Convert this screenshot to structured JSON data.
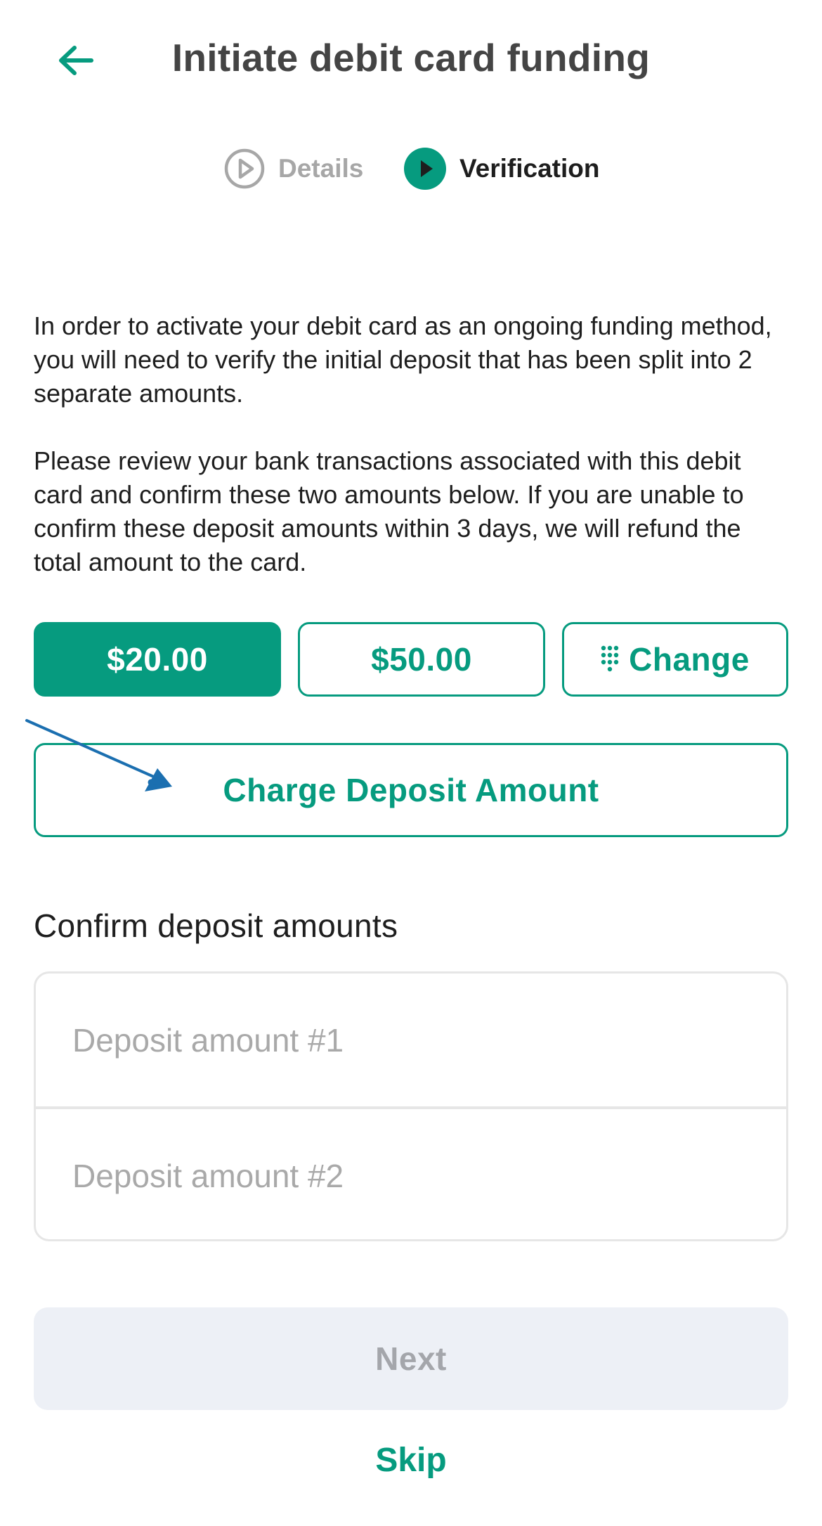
{
  "header": {
    "title": "Initiate debit card funding",
    "back_icon": "arrow-left-icon"
  },
  "stepper": {
    "steps": [
      {
        "label": "Details",
        "state": "inactive",
        "icon": "play-circle-outline-icon"
      },
      {
        "label": "Verification",
        "state": "active",
        "icon": "play-circle-filled-icon"
      }
    ]
  },
  "intro": {
    "paragraph_1": "In order to activate your debit card as an ongoing funding method, you will need to verify the initial deposit that has been split into 2 separate amounts.",
    "paragraph_2": "Please review your bank transactions associated with this debit card and confirm these two amounts below.  If you are unable to confirm these deposit amounts within 3 days, we will refund the total amount to the card."
  },
  "amounts": {
    "options": [
      {
        "label": "$20.00",
        "selected": true
      },
      {
        "label": "$50.00",
        "selected": false
      }
    ],
    "change_label": "Change",
    "change_icon": "keypad-icon"
  },
  "charge_button": {
    "label": "Charge Deposit Amount"
  },
  "confirm": {
    "title": "Confirm deposit amounts",
    "field_1_placeholder": "Deposit amount #1",
    "field_2_placeholder": "Deposit amount #2"
  },
  "actions": {
    "next_label": "Next",
    "skip_label": "Skip"
  },
  "colors": {
    "accent": "#069b7f",
    "title_text": "#444444",
    "body_text": "#1e1e1e",
    "muted_text": "#a7a7a7",
    "disabled_bg": "#edf0f6",
    "annotation_arrow": "#1b6fb0"
  }
}
